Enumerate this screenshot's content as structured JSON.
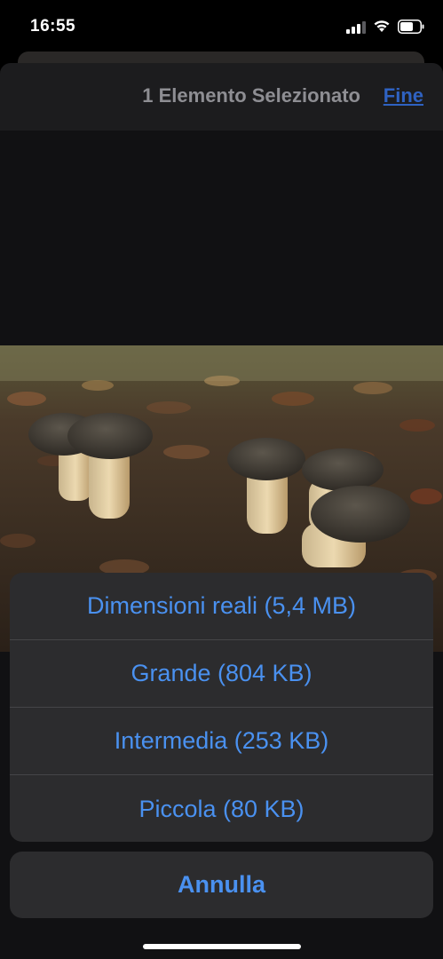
{
  "status_bar": {
    "time": "16:55",
    "icons": [
      "cellular-signal-icon",
      "wifi-icon",
      "battery-icon"
    ]
  },
  "header": {
    "title": "1 Elemento Selezionato",
    "done_label": "Fine"
  },
  "action_sheet": {
    "options": [
      {
        "label": "Dimensioni reali (5,4 MB)"
      },
      {
        "label": "Grande (804 KB)"
      },
      {
        "label": "Intermedia (253 KB)"
      },
      {
        "label": "Piccola (80 KB)"
      }
    ],
    "cancel_label": "Annulla"
  },
  "colors": {
    "accent": "#4a91f0",
    "done_link": "#2f62c2",
    "sheet_background": "#2c2c2e",
    "header_background": "#1c1c1e"
  }
}
